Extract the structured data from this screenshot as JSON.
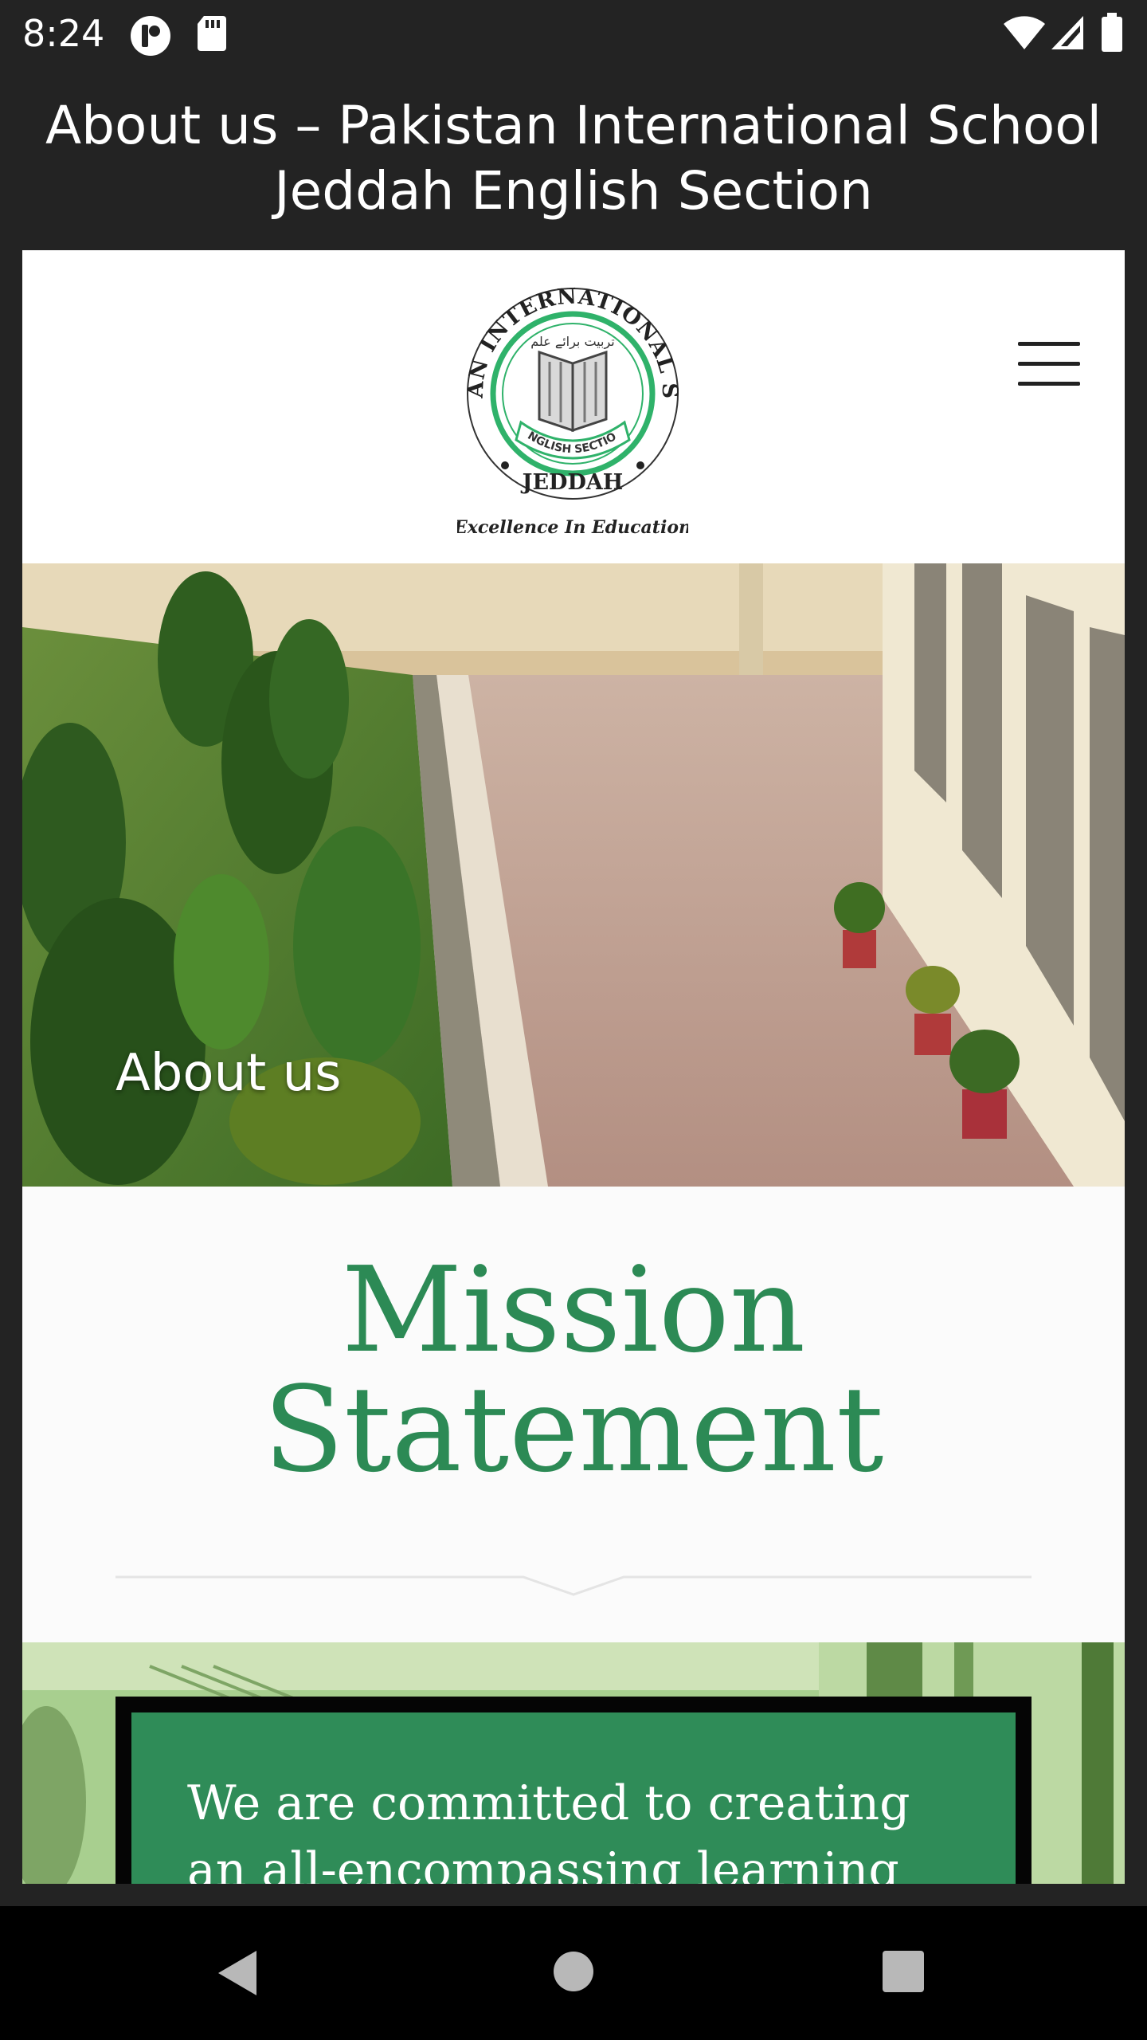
{
  "status_bar": {
    "time": "8:24",
    "left_icons": [
      "notification-app-icon",
      "sd-card-icon"
    ],
    "right_icons": [
      "wifi-icon",
      "cellular-signal-icon",
      "battery-icon"
    ]
  },
  "page_title": "About us – Pakistan International School Jeddah English Section",
  "site_header": {
    "logo": {
      "ring_text": "PAKISTAN INTERNATIONAL SCHOOL",
      "urdu_text": "تربیت برائے علم",
      "ribbon_text": "ENGLISH SECTION",
      "city": "JEDDAH",
      "tagline": "Excellence In Education"
    },
    "menu_icon": "hamburger-menu-icon"
  },
  "hero": {
    "title": "About us"
  },
  "mission": {
    "heading_line1": "Mission",
    "heading_line2": "Statement",
    "text": "We are committed to creating an all-encompassing learning community"
  },
  "navigation_bar": {
    "buttons": [
      "back-icon",
      "home-icon",
      "recents-icon"
    ]
  },
  "colors": {
    "brand_green": "#2c8a55",
    "mission_box": "#2f8c58",
    "system_bars": "#232323"
  }
}
